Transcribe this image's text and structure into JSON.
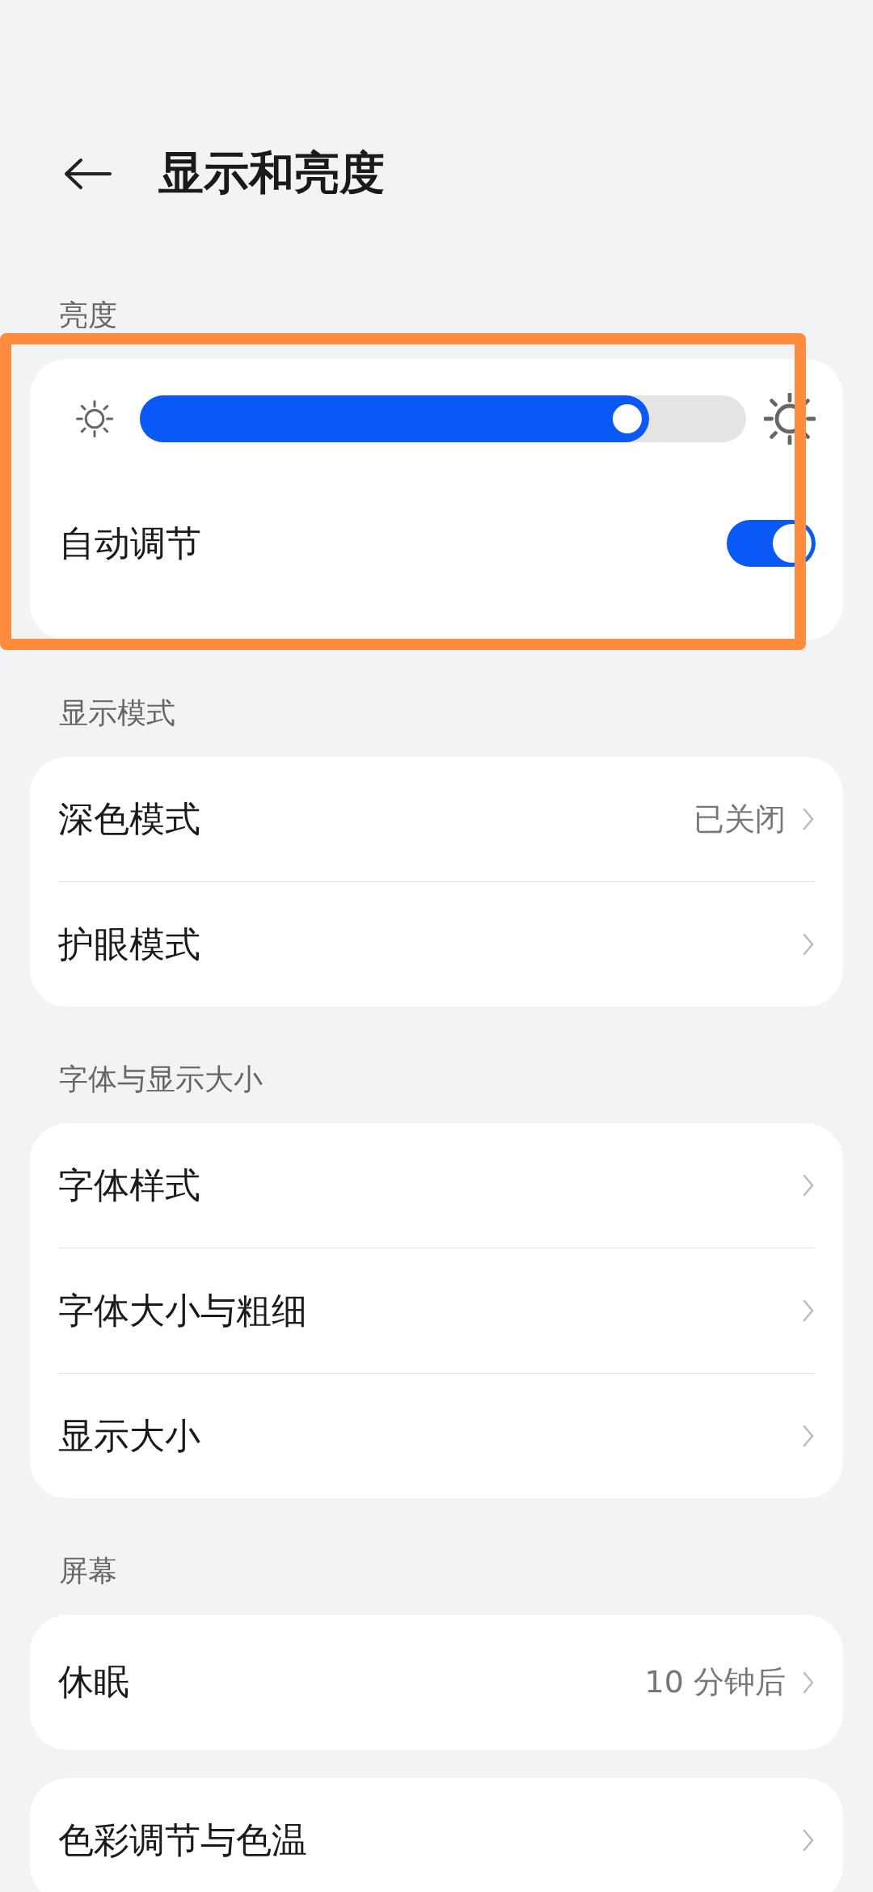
{
  "header": {
    "title": "显示和亮度"
  },
  "brightness": {
    "label": "亮度",
    "level": 0.84,
    "auto_label": "自动调节",
    "auto_on": true
  },
  "sections": [
    {
      "label": "显示模式",
      "rows": [
        {
          "label": "深色模式",
          "value": "已关闭"
        },
        {
          "label": "护眼模式"
        }
      ]
    },
    {
      "label": "字体与显示大小",
      "rows": [
        {
          "label": "字体样式"
        },
        {
          "label": "字体大小与粗细"
        },
        {
          "label": "显示大小"
        }
      ]
    },
    {
      "label": "屏幕",
      "rows": [
        {
          "label": "休眠",
          "value": "10 分钟后"
        }
      ]
    },
    {
      "rows": [
        {
          "label": "色彩调节与色温"
        }
      ]
    }
  ]
}
